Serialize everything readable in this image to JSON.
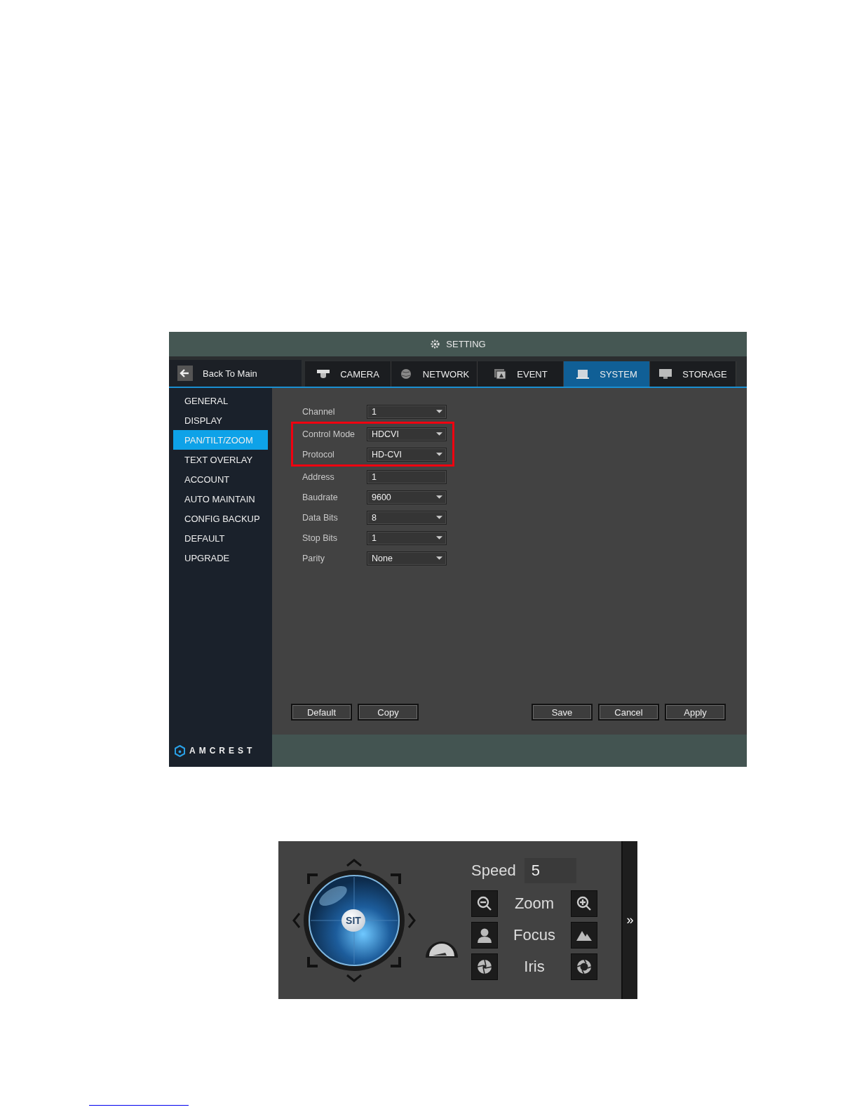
{
  "setting_window": {
    "title": "SETTING",
    "back_label": "Back To Main",
    "tabs": [
      {
        "label": "CAMERA",
        "kind": "camera",
        "selected": false
      },
      {
        "label": "NETWORK",
        "kind": "network",
        "selected": false
      },
      {
        "label": "EVENT",
        "kind": "event",
        "selected": false
      },
      {
        "label": "SYSTEM",
        "kind": "system",
        "selected": true
      },
      {
        "label": "STORAGE",
        "kind": "storage",
        "selected": false
      }
    ],
    "sidebar": {
      "items": [
        {
          "label": "GENERAL",
          "selected": false
        },
        {
          "label": "DISPLAY",
          "selected": false
        },
        {
          "label": "PAN/TILT/ZOOM",
          "selected": true
        },
        {
          "label": "TEXT OVERLAY",
          "selected": false
        },
        {
          "label": "ACCOUNT",
          "selected": false
        },
        {
          "label": "AUTO MAINTAIN",
          "selected": false
        },
        {
          "label": "CONFIG BACKUP",
          "selected": false
        },
        {
          "label": "DEFAULT",
          "selected": false
        },
        {
          "label": "UPGRADE",
          "selected": false
        }
      ]
    },
    "fields": [
      {
        "label": "Channel",
        "value": "1",
        "kind": "dropdown",
        "highlighted": false
      },
      {
        "label": "Control Mode",
        "value": "HDCVI",
        "kind": "dropdown",
        "highlighted": true
      },
      {
        "label": "Protocol",
        "value": "HD-CVI",
        "kind": "dropdown",
        "highlighted": true
      },
      {
        "label": "Address",
        "value": "1",
        "kind": "text",
        "highlighted": false
      },
      {
        "label": "Baudrate",
        "value": "9600",
        "kind": "dropdown",
        "highlighted": false
      },
      {
        "label": "Data Bits",
        "value": "8",
        "kind": "dropdown",
        "highlighted": false
      },
      {
        "label": "Stop Bits",
        "value": "1",
        "kind": "dropdown",
        "highlighted": false
      },
      {
        "label": "Parity",
        "value": "None",
        "kind": "dropdown",
        "highlighted": false
      }
    ],
    "left_buttons": [
      "Default",
      "Copy"
    ],
    "right_buttons": [
      "Save",
      "Cancel",
      "Apply"
    ],
    "logo": "AMCREST"
  },
  "ptz_panel": {
    "center_label": "SIT",
    "speed_label": "Speed",
    "speed_value": "5",
    "controls": [
      {
        "label": "Zoom",
        "kind": "zoom"
      },
      {
        "label": "Focus",
        "kind": "focus"
      },
      {
        "label": "Iris",
        "kind": "iris"
      }
    ],
    "expand_glyph": "»"
  }
}
